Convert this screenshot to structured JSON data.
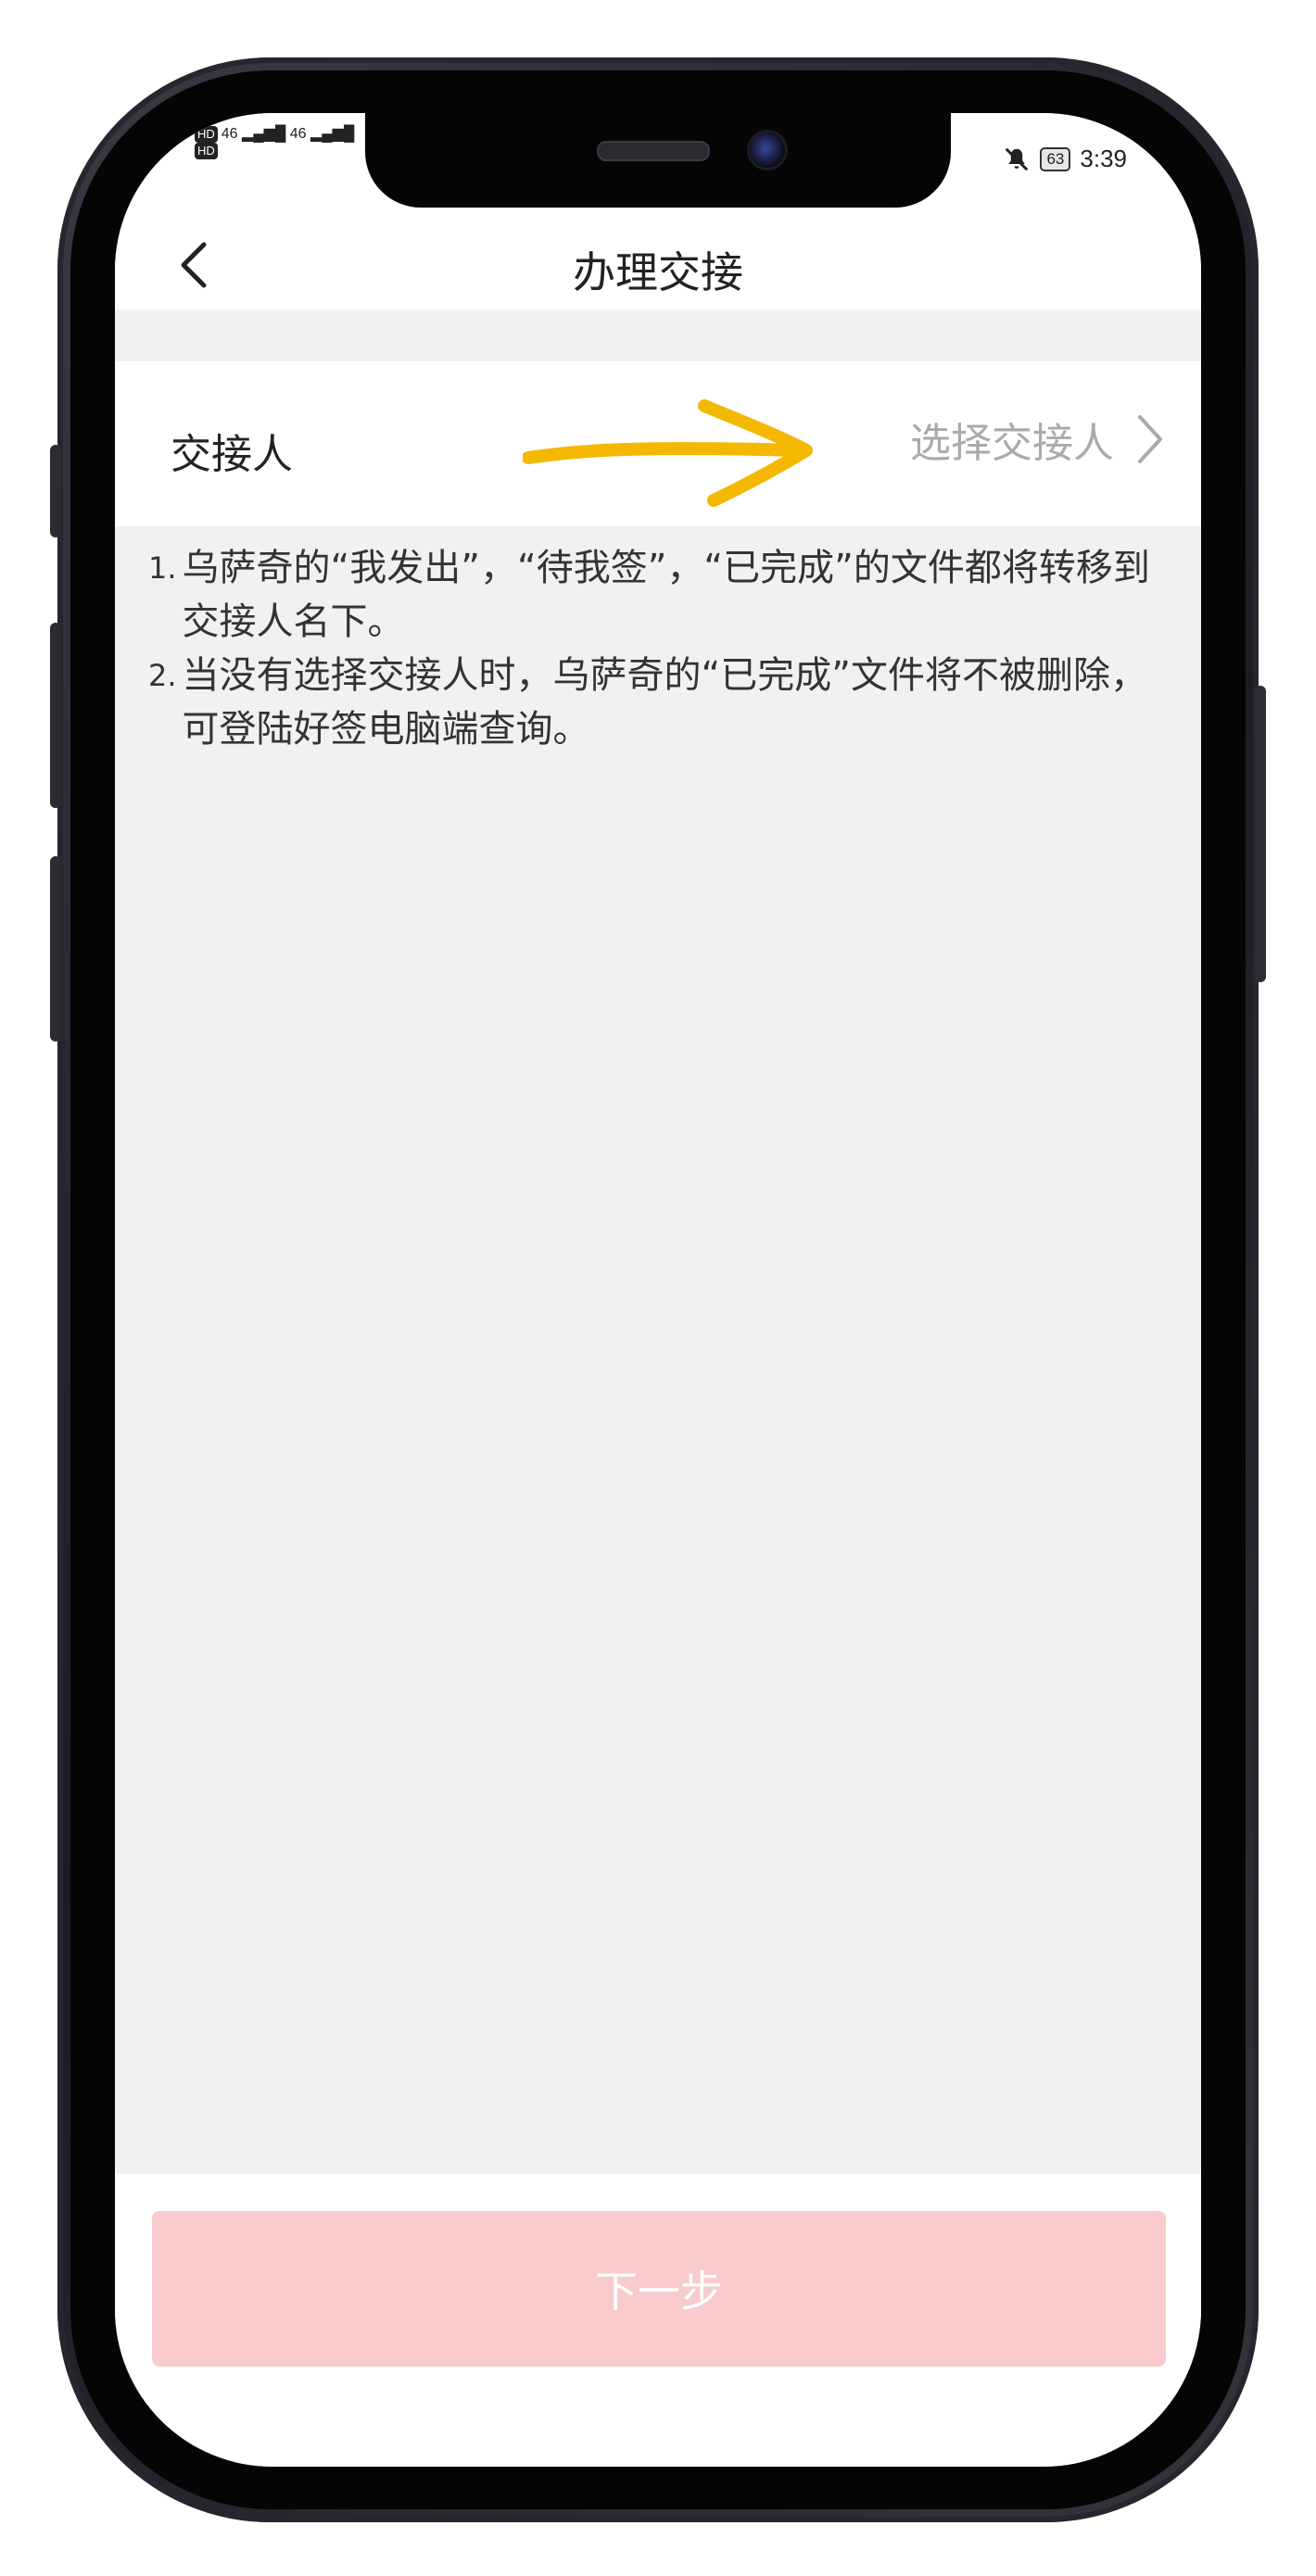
{
  "status_bar": {
    "left": "HD 46 46",
    "battery": "63",
    "time": "3:39"
  },
  "nav": {
    "back_icon": "chevron-left-icon",
    "title": "办理交接"
  },
  "handover": {
    "label": "交接人",
    "placeholder": "选择交接人",
    "chevron_icon": "chevron-right-icon",
    "annotation_color": "#f5b800"
  },
  "notes": [
    {
      "num": "1.",
      "text": "乌萨奇的“我发出”，“待我签”，“已完成”的文件都将转移到交接人名下。"
    },
    {
      "num": "2.",
      "text": "当没有选择交接人时，乌萨奇的“已完成”文件将不被删除，可登陆好签电脑端查询。"
    }
  ],
  "footer": {
    "next_label": "下一步",
    "next_color": "#f9cbcd"
  }
}
